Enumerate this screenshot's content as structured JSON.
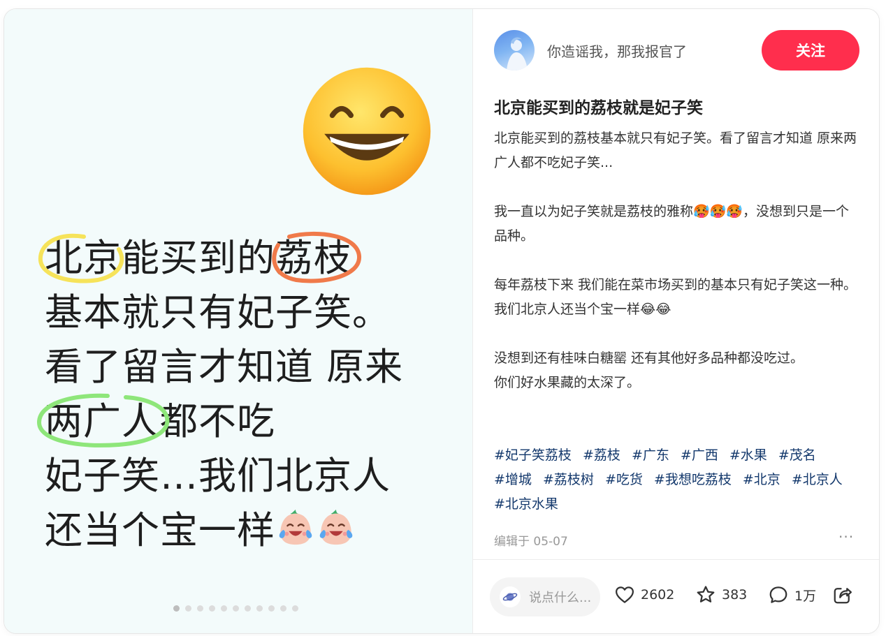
{
  "image_text": {
    "line1_a": "北京",
    "line1_b": "能买到的",
    "line1_c": "荔枝",
    "line2": "基本就只有妃子笑。",
    "line3": "看了留言才知道 原来",
    "line4_a": "两广人",
    "line4_b": "都不吃",
    "line5": "妃子笑…我们北京人",
    "line6": "还当个宝一样"
  },
  "carousel": {
    "total": 11,
    "current": 1
  },
  "author": {
    "name": "你造谣我，那我报官了",
    "follow_label": "关注"
  },
  "post": {
    "title": "北京能买到的荔枝就是妃子笑",
    "paragraphs": [
      "北京能买到的荔枝基本就只有妃子笑。看了留言才知道 原来两广人都不吃妃子笑...",
      "",
      "我一直以为妃子笑就是荔枝的雅称🥵🥵🥵，没想到只是一个品种。",
      "",
      "每年荔枝下来 我们能在菜市场买到的基本只有妃子笑这一种。我们北京人还当个宝一样😂😂",
      "",
      "没想到还有桂味白糖罂 还有其他好多品种都没吃过。",
      "你们好水果藏的太深了。"
    ],
    "tags": [
      "#妃子笑荔枝",
      "#荔枝",
      "#广东",
      "#广西",
      "#水果",
      "#茂名",
      "#增城",
      "#荔枝树",
      "#吃货",
      "#我想吃荔枝",
      "#北京",
      "#北京人",
      "#北京水果"
    ],
    "edit_date": "编辑于 05-07",
    "more": "···"
  },
  "bottom": {
    "comment_placeholder": "说点什么...",
    "likes": "2602",
    "collects": "383",
    "comments": "1万"
  },
  "colors": {
    "accent": "#ff2e4d",
    "tag": "#13386c",
    "highlight_yellow": "#f6e35a",
    "highlight_orange": "#f07a4a",
    "highlight_green": "#8ee67a"
  },
  "icons": [
    "smiling-face-emoji",
    "crying-laughing-peach-icon",
    "planet-icon",
    "heart-icon",
    "star-icon",
    "comment-bubble-icon",
    "share-icon"
  ]
}
